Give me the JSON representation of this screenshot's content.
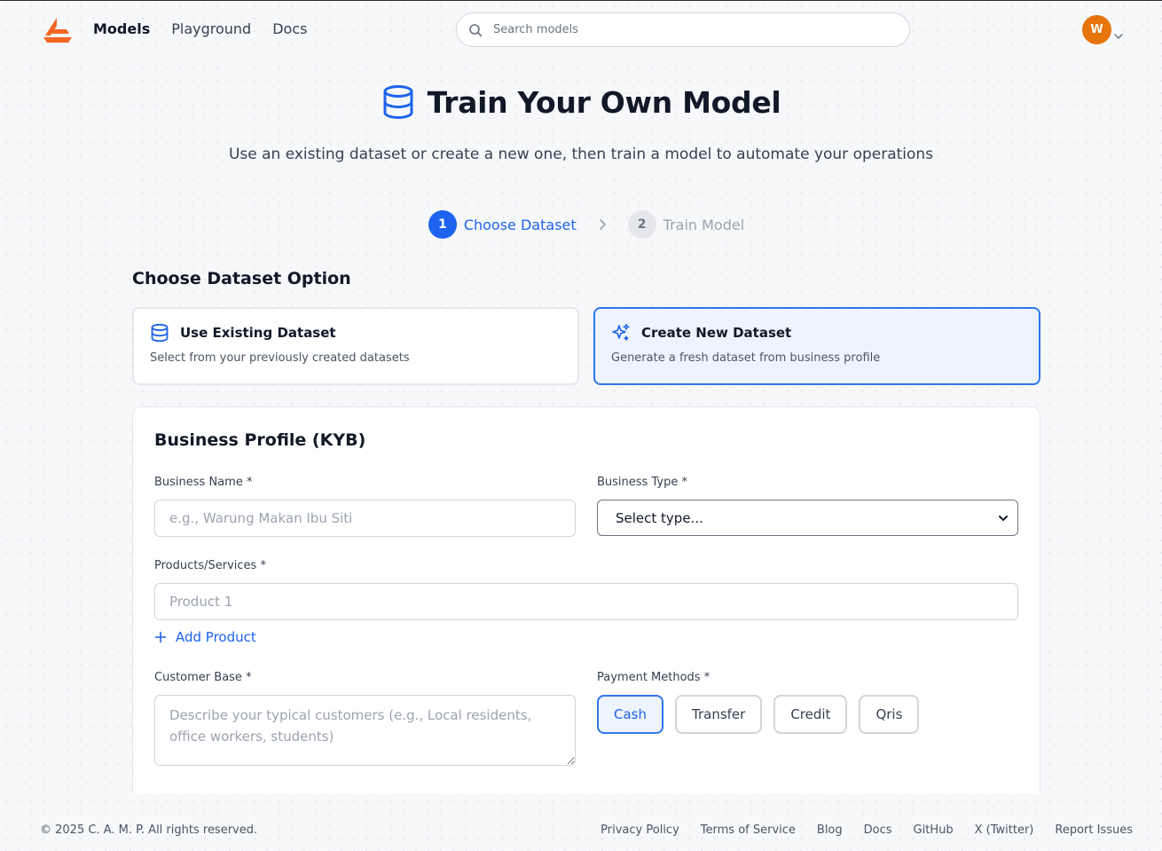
{
  "header": {
    "nav": [
      {
        "label": "Models",
        "active": true
      },
      {
        "label": "Playground",
        "active": false
      },
      {
        "label": "Docs",
        "active": false
      }
    ],
    "search_placeholder": "Search models",
    "avatar_initial": "W",
    "brand_color": "#f26722",
    "avatar_color": "#e8740c"
  },
  "hero": {
    "title": "Train Your Own Model",
    "subtitle": "Use an existing dataset or create a new one, then train a model to automate your operations",
    "icon": "database-icon"
  },
  "stepper": {
    "steps": [
      {
        "number": "1",
        "label": "Choose Dataset",
        "active": true
      },
      {
        "number": "2",
        "label": "Train Model",
        "active": false
      }
    ]
  },
  "dataset_options": {
    "heading": "Choose Dataset Option",
    "options": [
      {
        "title": "Use Existing Dataset",
        "description": "Select from your previously created datasets",
        "icon": "database-icon",
        "selected": false
      },
      {
        "title": "Create New Dataset",
        "description": "Generate a fresh dataset from business profile",
        "icon": "sparkles-icon",
        "selected": true
      }
    ]
  },
  "business_profile": {
    "heading": "Business Profile (KYB)",
    "business_name": {
      "label": "Business Name *",
      "placeholder": "e.g., Warung Makan Ibu Siti",
      "value": ""
    },
    "business_type": {
      "label": "Business Type *",
      "selected": "Select type..."
    },
    "products": {
      "label": "Products/Services *",
      "placeholder": "Product 1",
      "add_label": "Add Product"
    },
    "customer_base": {
      "label": "Customer Base *",
      "placeholder": "Describe your typical customers (e.g., Local residents, office workers, students)"
    },
    "payment_methods": {
      "label": "Payment Methods *",
      "options": [
        {
          "label": "Cash",
          "selected": true
        },
        {
          "label": "Transfer",
          "selected": false
        },
        {
          "label": "Credit",
          "selected": false
        },
        {
          "label": "Qris",
          "selected": false
        }
      ]
    }
  },
  "footer": {
    "copyright": "© 2025 C. A. M. P. All rights reserved.",
    "links": [
      "Privacy Policy",
      "Terms of Service",
      "Blog",
      "Docs",
      "GitHub",
      "X (Twitter)",
      "Report Issues"
    ]
  },
  "colors": {
    "primary": "#1d63ed",
    "selected_bg": "#eef4fd",
    "selected_border": "#2f76eb"
  }
}
